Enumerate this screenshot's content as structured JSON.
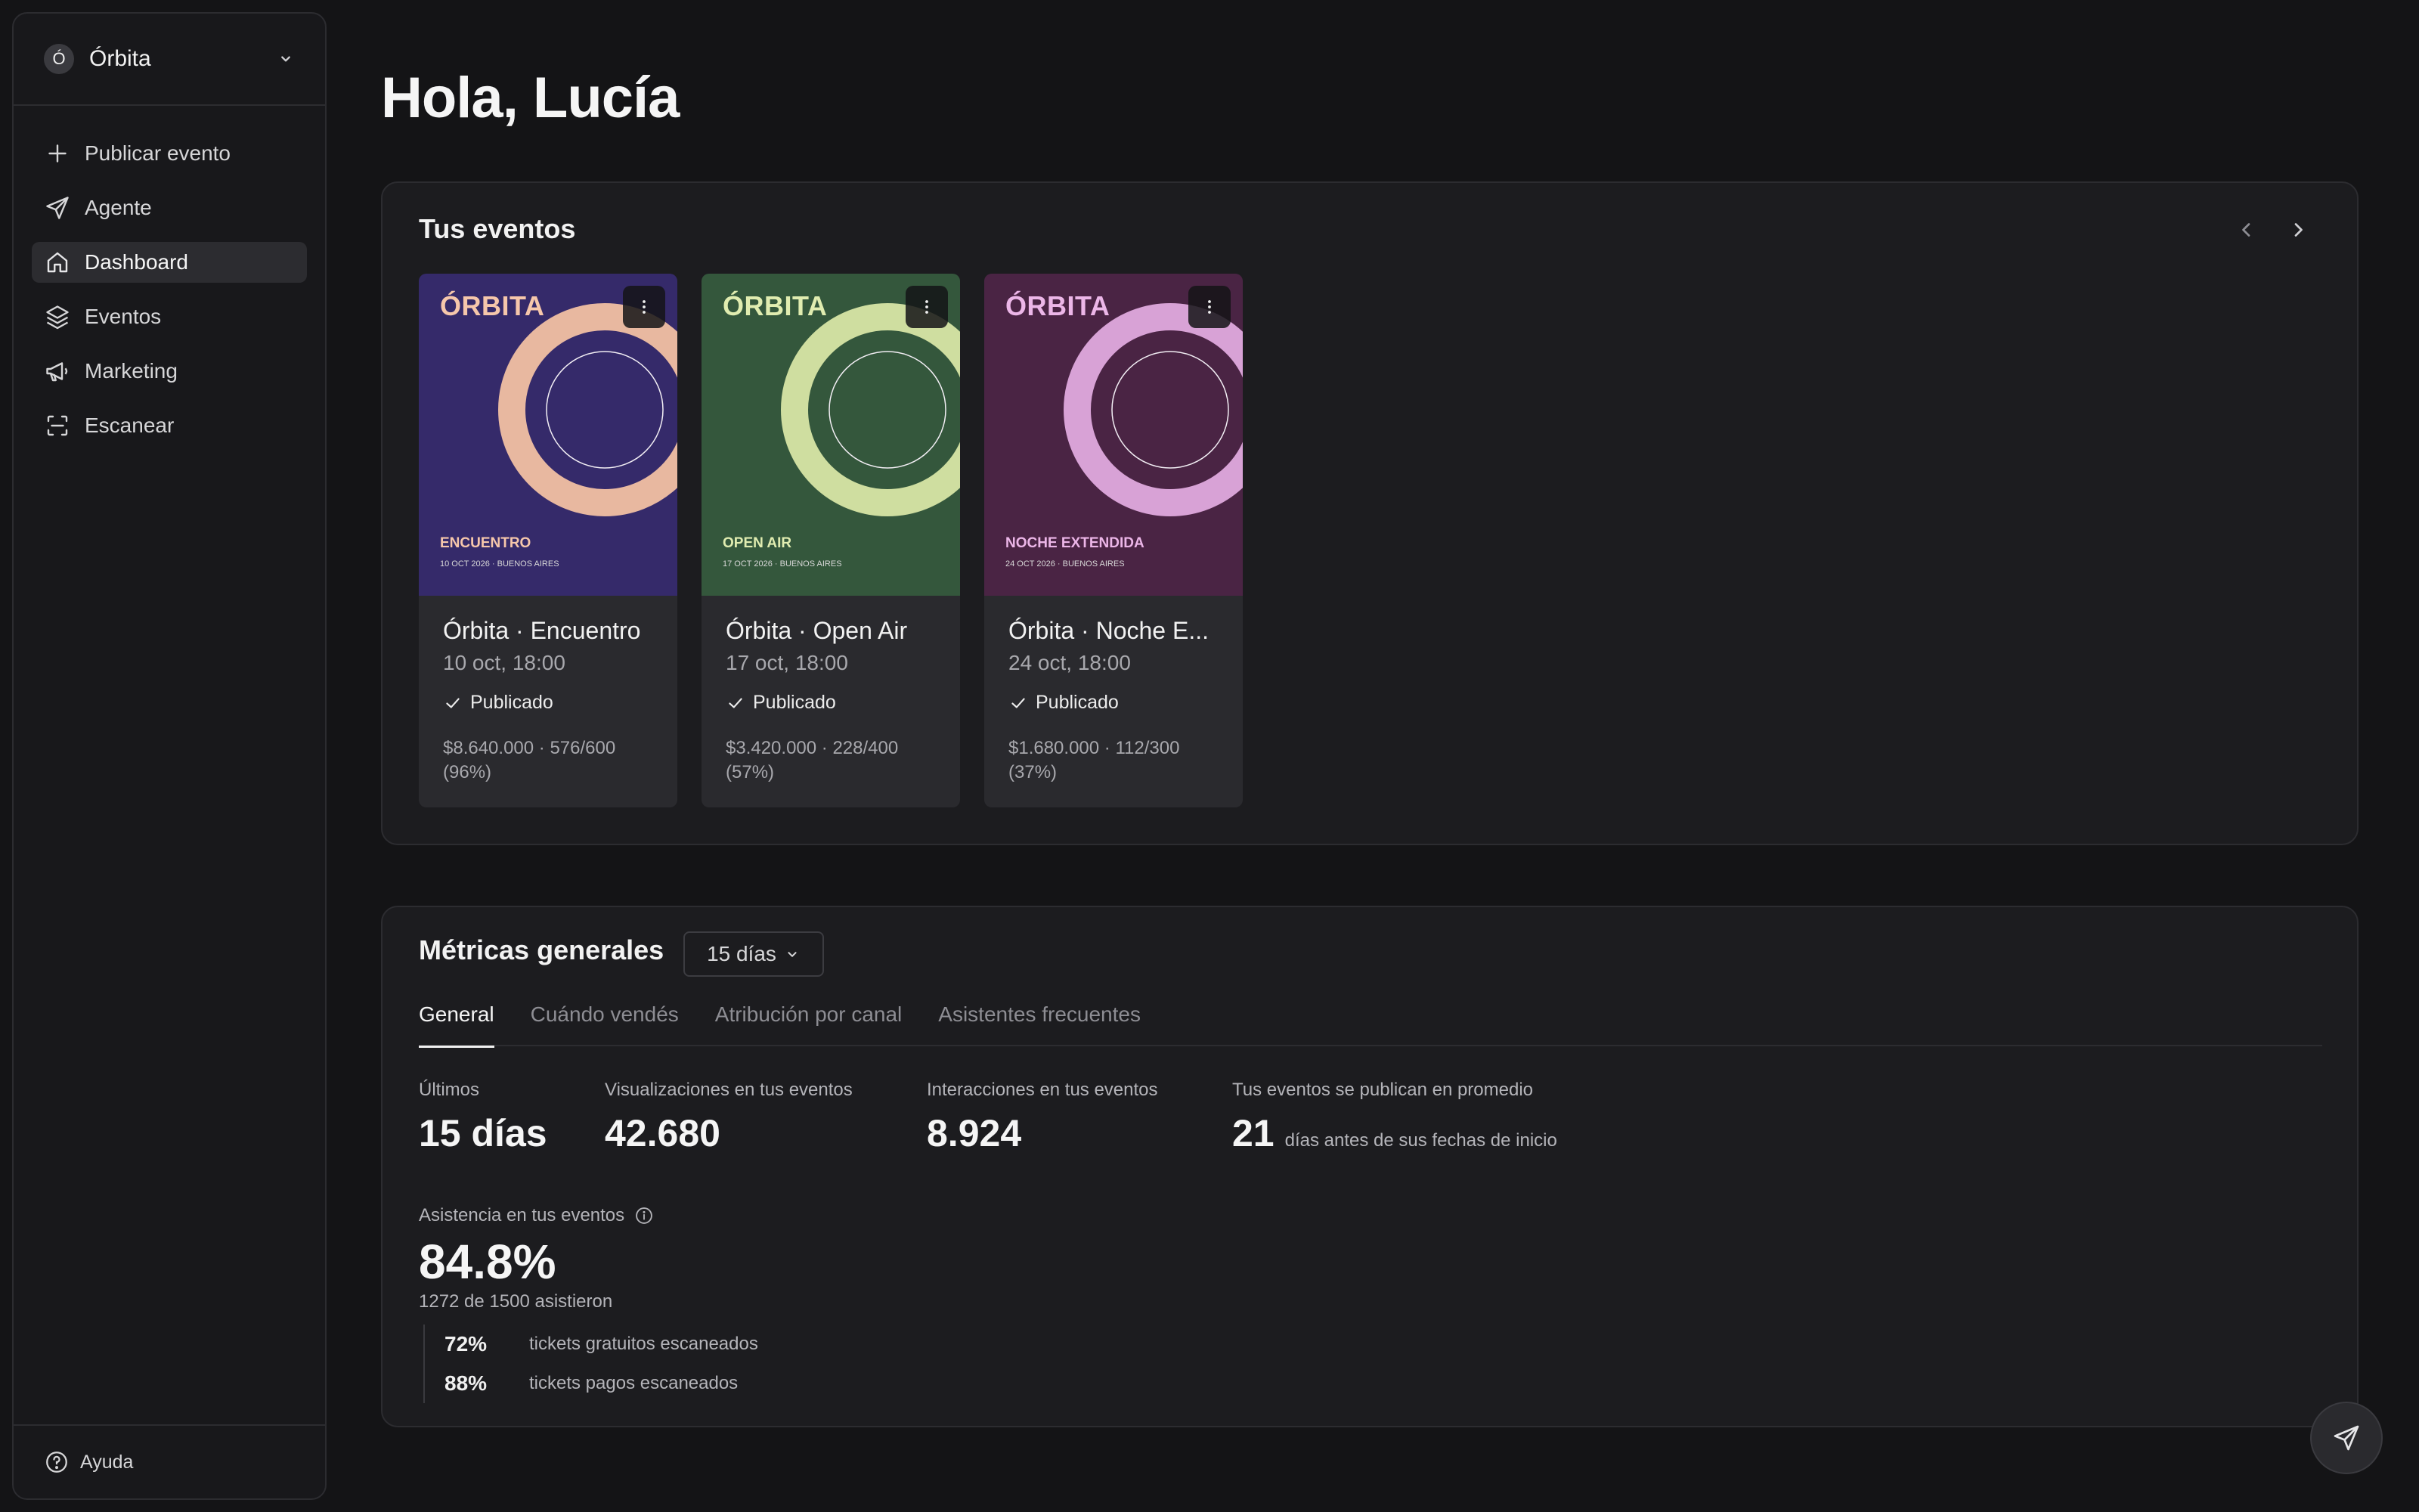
{
  "org": {
    "initial": "Ó",
    "name": "Órbita"
  },
  "nav": [
    {
      "label": "Publicar evento",
      "icon": "plus-icon"
    },
    {
      "label": "Agente",
      "icon": "send-icon"
    },
    {
      "label": "Dashboard",
      "icon": "home-icon",
      "active": true
    },
    {
      "label": "Eventos",
      "icon": "layers-icon"
    },
    {
      "label": "Marketing",
      "icon": "megaphone-icon"
    },
    {
      "label": "Escanear",
      "icon": "scan-icon"
    }
  ],
  "help": {
    "label": "Ayuda",
    "icon": "help-circle-icon"
  },
  "greeting": "Hola, Lucía",
  "events": {
    "title": "Tus eventos",
    "cards": [
      {
        "poster_brand": "ÓRBITA",
        "poster_title": "ENCUENTRO",
        "poster_sub": "10 OCT 2026 · BUENOS AIRES",
        "name": "Órbita · Encuentro",
        "date": "10 oct, 18:00",
        "status": "Publicado",
        "sales_line1": "$8.640.000 · 576/600",
        "sales_line2": "(96%)",
        "colors": {
          "bg": "#352a6a",
          "ring": "#e8b8a0",
          "accent": "#f6c7ab"
        }
      },
      {
        "poster_brand": "ÓRBITA",
        "poster_title": "OPEN AIR",
        "poster_sub": "17 OCT 2026 · BUENOS AIRES",
        "name": "Órbita · Open Air",
        "date": "17 oct, 18:00",
        "status": "Publicado",
        "sales_line1": "$3.420.000 · 228/400",
        "sales_line2": "(57%)",
        "colors": {
          "bg": "#34573c",
          "ring": "#cfdea0",
          "accent": "#e0ecb0"
        }
      },
      {
        "poster_brand": "ÓRBITA",
        "poster_title": "NOCHE EXTENDIDA",
        "poster_sub": "24 OCT 2026 · BUENOS AIRES",
        "name": "Órbita · Noche E...",
        "date": "24 oct, 18:00",
        "status": "Publicado",
        "sales_line1": "$1.680.000 · 112/300",
        "sales_line2": "(37%)",
        "colors": {
          "bg": "#4a2444",
          "ring": "#d8a2d6",
          "accent": "#ecb6e8"
        }
      }
    ]
  },
  "metrics": {
    "title": "Métricas generales",
    "range": "15 días",
    "tabs": [
      "General",
      "Cuándo vendés",
      "Atribución por canal",
      "Asistentes frecuentes"
    ],
    "stats": {
      "period_label": "Últimos",
      "period_value": "15 días",
      "views_label": "Visualizaciones en tus eventos",
      "views_value": "42.680",
      "interactions_label": "Interacciones en tus eventos",
      "interactions_value": "8.924",
      "publish_label": "Tus eventos se publican en promedio",
      "publish_value": "21",
      "publish_suffix": "días antes de sus fechas de inicio"
    },
    "attendance": {
      "label": "Asistencia en tus eventos",
      "value": "84.8%",
      "sub": "1272 de 1500 asistieron",
      "breakdown": [
        {
          "pct": "72%",
          "text": "tickets gratuitos escaneados"
        },
        {
          "pct": "88%",
          "text": "tickets pagos escaneados"
        }
      ]
    }
  }
}
